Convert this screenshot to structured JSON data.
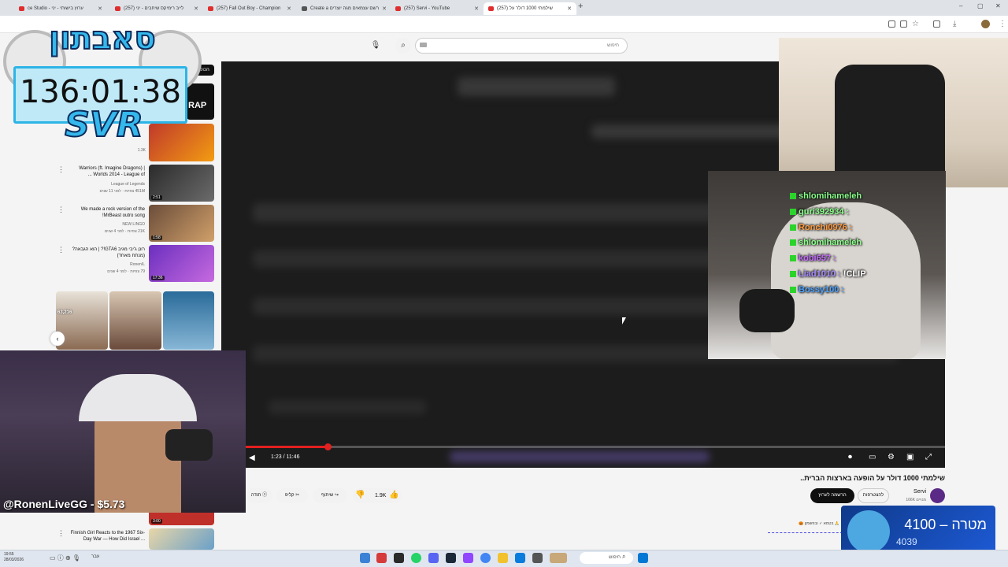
{
  "browser": {
    "tabs": [
      {
        "label": "ce Studio - ערוץ בישותי - יני"
      },
      {
        "label": "לייב רימיקס שיחבים - יני (257)"
      },
      {
        "label": "(257) Fall Out Boy - Champion"
      },
      {
        "label": "Create a רשם עצמאים מגה יוצרים"
      },
      {
        "label": "(257) Servi - YouTube"
      },
      {
        "label": "(257) שילמתי 1000 דולר על"
      }
    ],
    "window_controls": [
      "–",
      "▢",
      "✕"
    ]
  },
  "youtube": {
    "search_placeholder": "חיפוש",
    "video": {
      "timecode": "1:23 / 11:46",
      "progress": 0.117,
      "title": "שילמתי 1000 דולר על הופעה בארצות הברית..",
      "channel": "Servi",
      "subscribers": "166K מנויים",
      "join_label": "להצטרפות",
      "subscribe_label": "הרשמה לערוץ",
      "likes": "1.9K",
      "share_label": "שיתוף",
      "clip_label": "קליפ",
      "save_label": "תודה"
    },
    "comment_snippet": "בלייק, 🙏 בטמא ✓ ובפשמון 🎃",
    "sidebar_chip": "הכול",
    "sidebar": [
      {
        "title": "",
        "channel": "",
        "meta": "1.3K",
        "duration": ""
      },
      {
        "title": "Warriors (ft. Imagine Dragons) | Worlds 2014 - League of ...",
        "channel": "League of Legends",
        "meta": "451M צפיות · לפני 11 שנים",
        "duration": "2:51"
      },
      {
        "title": "We made a rock version of the MrBeast outro song!",
        "channel": "NEW LINGO",
        "meta": "21K צפיות · לפני 4 שנים",
        "duration": "1:58"
      },
      {
        "title": "רונן ג'יבי מגיב GTA6!? | הוא הגבאה? (מנתח מאחד)",
        "channel": "RonenIL",
        "meta": "79 צפיות · לפני 4 שנים",
        "duration": "17:36"
      },
      {
        "title": "Finnish Girl Reacts to the 1967 Six-Day War — How Did Israel ...",
        "channel": "",
        "meta": "",
        "duration": "3:00"
      }
    ],
    "shorts_views": "63,216"
  },
  "overlay": {
    "timer": "136:01:38",
    "logo_top": "סאבתון",
    "logo_bottom": "SVR",
    "streamer_handle": "@RonenLiveGG - $5.73",
    "chat": [
      {
        "user": "shlomihameleh",
        "message": "",
        "color": "#8aff8a"
      },
      {
        "user": "guri392934 :",
        "message": "",
        "color": "#8aff8a"
      },
      {
        "user": "Ronchi0976 :",
        "message": "",
        "color": "#ff9a3c"
      },
      {
        "user": "shlomihameleh",
        "message": "",
        "color": "#8aff8a"
      },
      {
        "user": "kobi657 :",
        "message": "",
        "color": "#c46bff"
      },
      {
        "user": "Liad1010 :",
        "message": "!CLIP",
        "color": "#a78bff"
      },
      {
        "user": "Bossy100 :",
        "message": "",
        "color": "#4da3ff"
      }
    ],
    "goal_label": "מטרה – 4100",
    "goal_current": "4039"
  },
  "taskbar": {
    "search": "חיפוש",
    "time": "19:55",
    "date": "28/03/2026",
    "lang": "עבר"
  },
  "colors": {
    "accent_red": "#e32020",
    "timer_border": "#2db4e6"
  }
}
